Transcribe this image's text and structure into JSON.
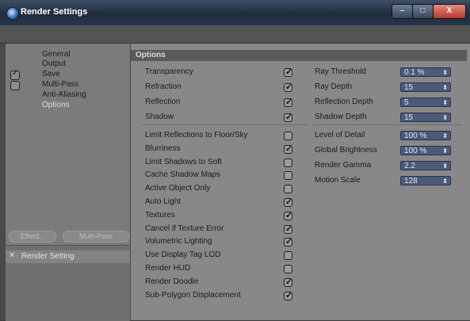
{
  "window": {
    "title": "Render Settings",
    "min_label": "–",
    "max_label": "□",
    "close_label": "X"
  },
  "sidebar": {
    "items": [
      {
        "label": "General",
        "checked": null
      },
      {
        "label": "Output",
        "checked": null
      },
      {
        "label": "Save",
        "checked": true
      },
      {
        "label": "Multi-Pass",
        "checked": false
      },
      {
        "label": "Anti-Aliasing",
        "checked": null
      },
      {
        "label": "Options",
        "checked": null,
        "active": true
      }
    ],
    "effect_button": "Effect...",
    "multipass_button": "Multi-Pass",
    "render_setting_label": "Render Setting"
  },
  "options": {
    "header": "Options",
    "group1": [
      {
        "label": "Transparency",
        "checked": true
      },
      {
        "label": "Refraction",
        "checked": true
      },
      {
        "label": "Reflection",
        "checked": true
      },
      {
        "label": "Shadow",
        "checked": true
      }
    ],
    "group2": [
      {
        "label": "Limit Reflections to Floor/Sky",
        "checked": false
      },
      {
        "label": "Blurriness",
        "checked": true
      },
      {
        "label": "Limit Shadows to Soft",
        "checked": false
      },
      {
        "label": "Cache Shadow Maps",
        "checked": false
      },
      {
        "label": "Active Object Only",
        "checked": false
      },
      {
        "label": "Auto Light",
        "checked": true
      },
      {
        "label": "Textures",
        "checked": true
      },
      {
        "label": "Cancel if Texture Error",
        "checked": true
      },
      {
        "label": "Volumetric Lighting",
        "checked": true
      },
      {
        "label": "Use Display Tag LOD",
        "checked": false
      },
      {
        "label": "Render HUD",
        "checked": false
      },
      {
        "label": "Render Doodle",
        "checked": true
      },
      {
        "label": "Sub-Polygon Displacement",
        "checked": true
      }
    ],
    "fields1": [
      {
        "label": "Ray Threshold",
        "value": "0.1 %"
      },
      {
        "label": "Ray Depth",
        "value": "15"
      },
      {
        "label": "Reflection Depth",
        "value": "5"
      },
      {
        "label": "Shadow Depth",
        "value": "15"
      }
    ],
    "fields2": [
      {
        "label": "Level of Detail",
        "value": "100 %"
      },
      {
        "label": "Global Brightness",
        "value": "100 %"
      },
      {
        "label": "Render Gamma",
        "value": "2.2"
      },
      {
        "label": "Motion Scale",
        "value": "128"
      }
    ]
  },
  "colors": {
    "field_bg": "#4b5a7a",
    "titlebar": "#1f2c3d",
    "close_button": "#b8372a"
  }
}
